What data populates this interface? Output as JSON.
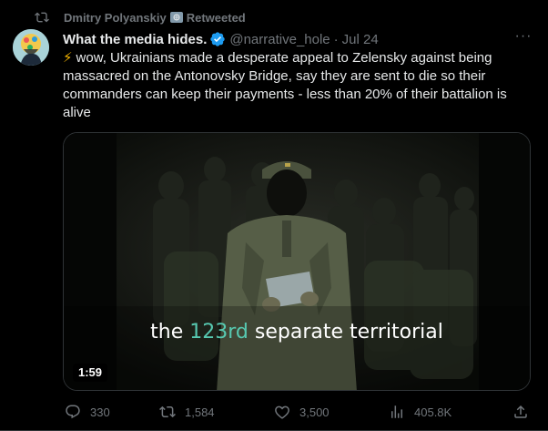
{
  "retweet": {
    "user": "Dmitry Polyanskiy",
    "label": "Retweeted"
  },
  "author": {
    "name": "What the media hides.",
    "handle": "@narrative_hole",
    "separator": "·",
    "date": "Jul 24"
  },
  "tweet": {
    "emoji": "⚡",
    "text": "wow, Ukrainians made a desperate appeal to Zelensky against being massacred on the Antonovsky Bridge, say they are sent to die so their commanders can keep their payments - less than 20% of their battalion is alive"
  },
  "video": {
    "caption_before": "the ",
    "caption_highlight": "123rd",
    "caption_after": " separate territorial",
    "duration": "1:59",
    "highlight_color": "#57c9b1"
  },
  "actions": {
    "replies": "330",
    "retweets": "1,584",
    "likes": "3,500",
    "views": "405.8K"
  },
  "colors": {
    "background": "#000000",
    "secondary_text": "#71767b",
    "verified": "#1d9bf0"
  },
  "icons": [
    "retweet-icon",
    "government-badge-icon",
    "verified-badge-icon",
    "more-icon",
    "reply-icon",
    "views-icon",
    "like-icon",
    "share-icon"
  ]
}
